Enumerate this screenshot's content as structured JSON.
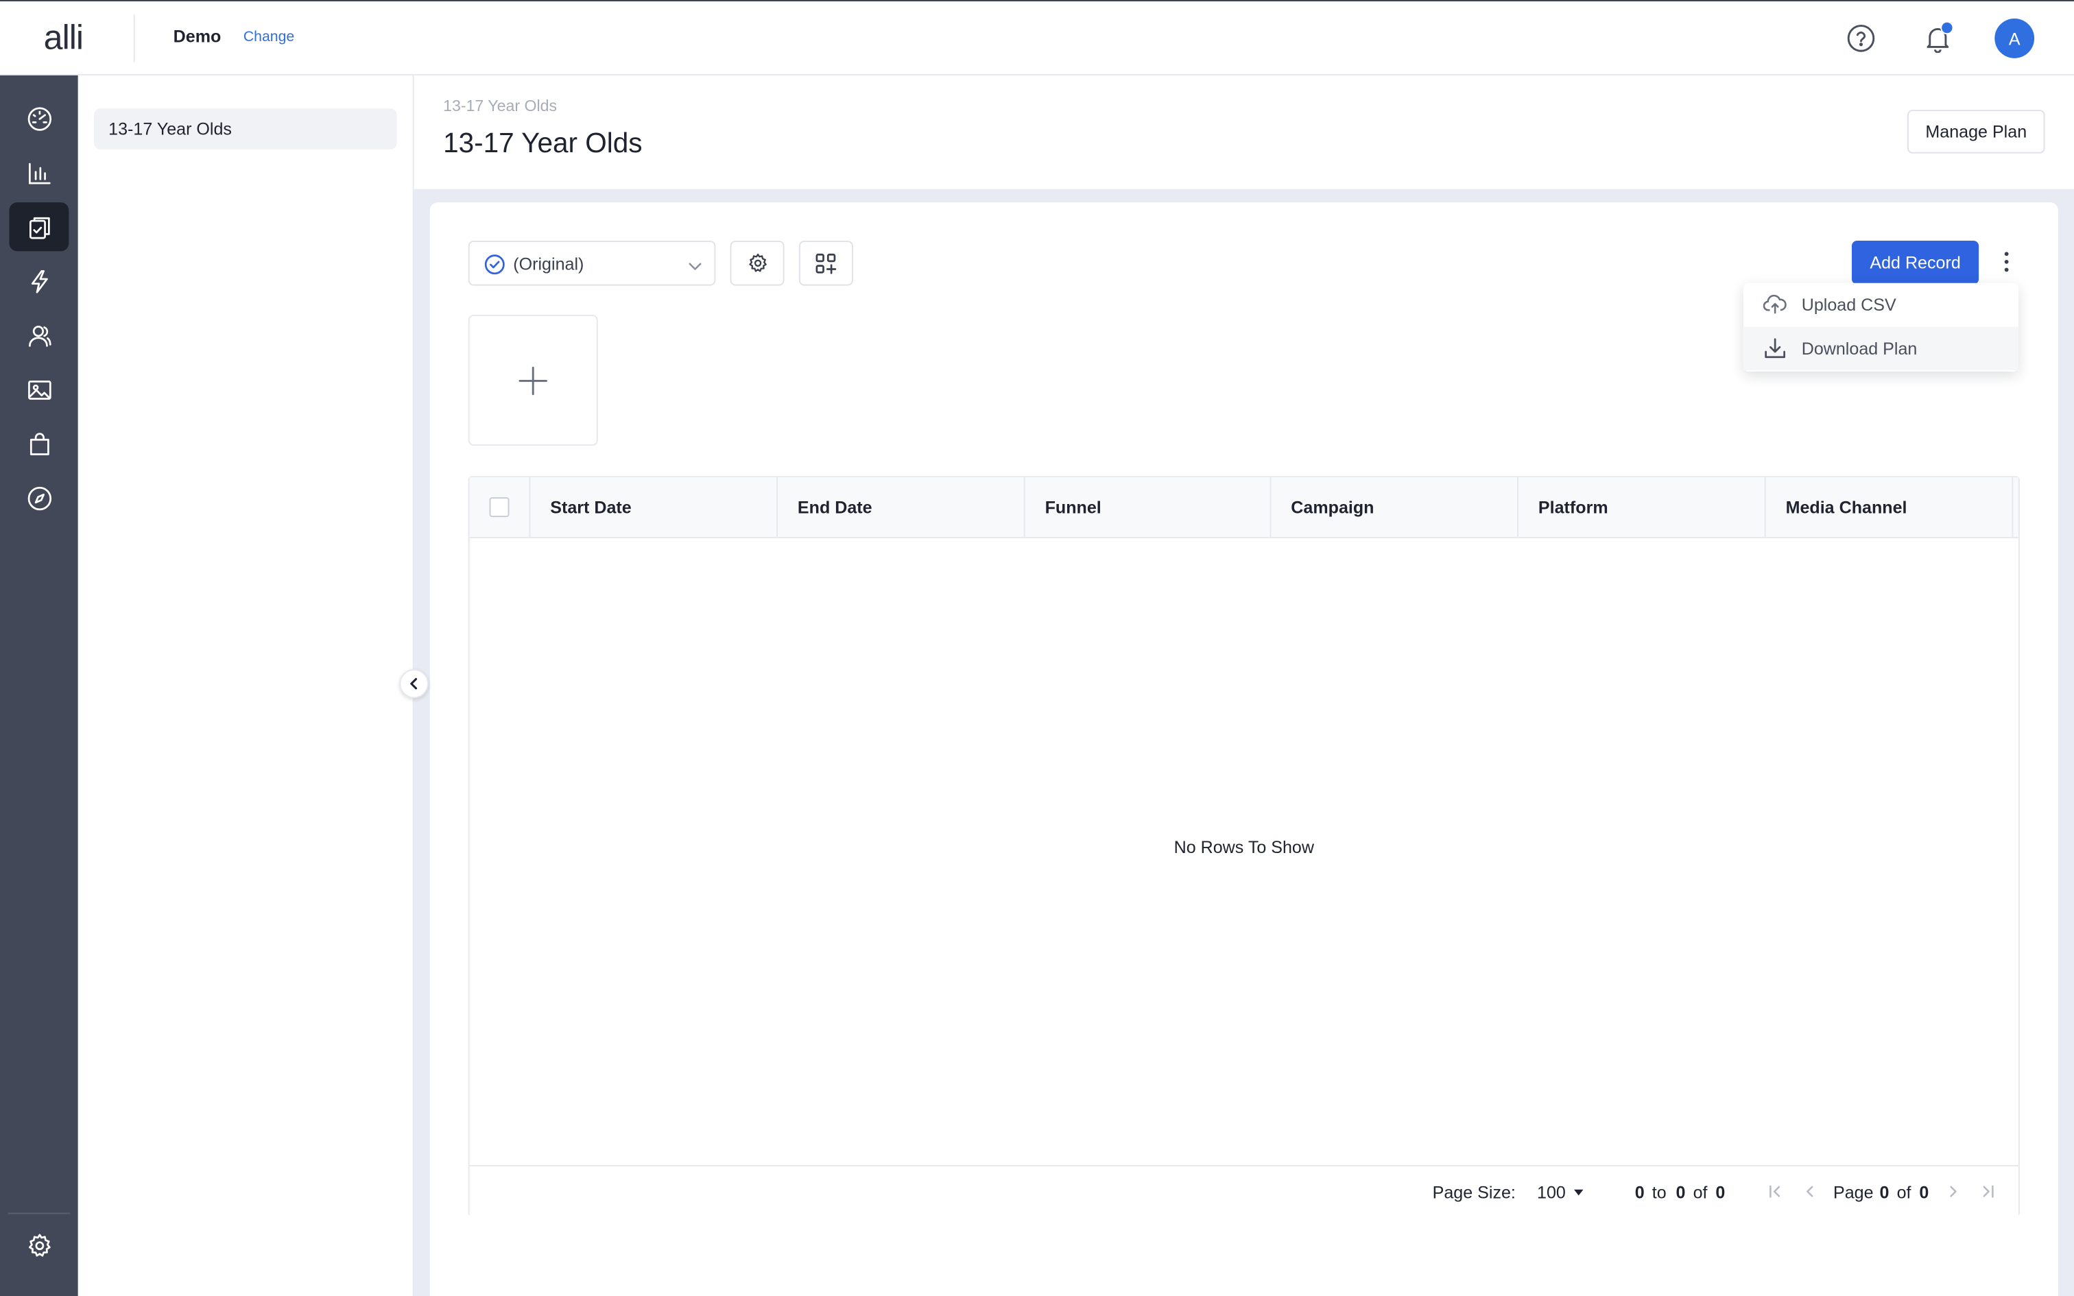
{
  "header": {
    "logo": "alli",
    "client_name": "Demo",
    "client_change": "Change",
    "avatar_initial": "A"
  },
  "rail": {
    "items": [
      "dashboard-icon",
      "bar-chart-icon",
      "clipboard-check-icon",
      "lightning-icon",
      "audience-icon",
      "image-icon",
      "shopping-bag-icon",
      "compass-icon"
    ],
    "active": "clipboard-check-icon",
    "bottom": "gear-icon"
  },
  "subnav": {
    "items": [
      {
        "label": "13-17 Year Olds"
      }
    ]
  },
  "page": {
    "breadcrumb": "13-17 Year Olds",
    "title": "13-17 Year Olds",
    "manage_plan": "Manage Plan"
  },
  "toolbar": {
    "version": "(Original)",
    "add_record": "Add Record"
  },
  "menu": {
    "items": [
      {
        "label": "Upload CSV",
        "icon": "cloud-upload-icon"
      },
      {
        "label": "Download Plan",
        "icon": "download-icon"
      }
    ]
  },
  "grid": {
    "columns": [
      "Start Date",
      "End Date",
      "Funnel",
      "Campaign",
      "Platform",
      "Media Channel"
    ],
    "empty": "No Rows To Show",
    "footer": {
      "page_size_label": "Page Size:",
      "page_size": "100",
      "range_start": "0",
      "range_to": "to",
      "range_end": "0",
      "range_of": "of",
      "range_total": "0",
      "page_label": "Page",
      "page_current": "0",
      "page_of": "of",
      "page_total": "0"
    }
  },
  "colors": {
    "accent": "#2f63e0",
    "rail_bg": "#434859",
    "rail_active": "#1e222c",
    "content_bg": "#e8ebf3"
  }
}
